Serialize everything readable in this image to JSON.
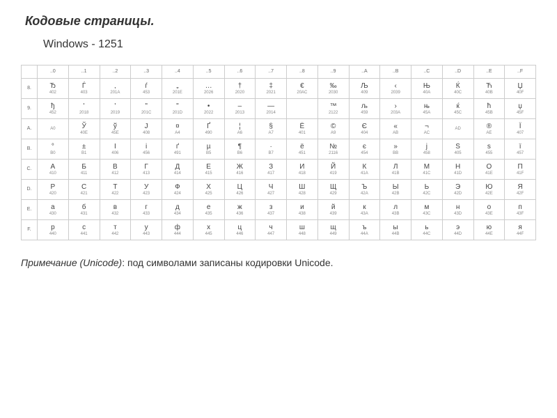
{
  "title": "Кодовые страницы.",
  "subtitle": "Windows - 1251",
  "note": {
    "label": "Примечание (Unicode)",
    "text": ": под символами записаны кодировки Unicode."
  },
  "chart_data": {
    "type": "table",
    "columns": [
      "..0",
      "..1",
      "..2",
      "..3",
      "..4",
      "..5",
      "..6",
      "..7",
      "..8",
      "..9",
      "..A",
      "..B",
      "..C",
      "..D",
      "..E",
      "..F"
    ],
    "row_labels": [
      "8.",
      "9.",
      "A.",
      "B.",
      "C.",
      "D.",
      "E.",
      "F."
    ],
    "cells": [
      [
        {
          "ch": "Ђ",
          "cd": "402"
        },
        {
          "ch": "Ѓ",
          "cd": "403"
        },
        {
          "ch": "‚",
          "cd": "201A"
        },
        {
          "ch": "ѓ",
          "cd": "453"
        },
        {
          "ch": "„",
          "cd": "201E"
        },
        {
          "ch": "…",
          "cd": "2026"
        },
        {
          "ch": "†",
          "cd": "2020"
        },
        {
          "ch": "‡",
          "cd": "2021"
        },
        {
          "ch": "€",
          "cd": "20AC"
        },
        {
          "ch": "‰",
          "cd": "2030"
        },
        {
          "ch": "Љ",
          "cd": "409"
        },
        {
          "ch": "‹",
          "cd": "2039"
        },
        {
          "ch": "Њ",
          "cd": "40A"
        },
        {
          "ch": "Ќ",
          "cd": "40C"
        },
        {
          "ch": "Ћ",
          "cd": "40B"
        },
        {
          "ch": "Џ",
          "cd": "40F"
        }
      ],
      [
        {
          "ch": "ђ",
          "cd": "452"
        },
        {
          "ch": "'",
          "cd": "2018"
        },
        {
          "ch": "'",
          "cd": "2019"
        },
        {
          "ch": "\"",
          "cd": "201C"
        },
        {
          "ch": "\"",
          "cd": "201D"
        },
        {
          "ch": "•",
          "cd": "2022"
        },
        {
          "ch": "–",
          "cd": "2013"
        },
        {
          "ch": "—",
          "cd": "2014"
        },
        {
          "ch": "",
          "cd": ""
        },
        {
          "ch": "™",
          "cd": "2122"
        },
        {
          "ch": "љ",
          "cd": "459"
        },
        {
          "ch": "›",
          "cd": "203A"
        },
        {
          "ch": "њ",
          "cd": "45A"
        },
        {
          "ch": "ќ",
          "cd": "45C"
        },
        {
          "ch": "ћ",
          "cd": "45B"
        },
        {
          "ch": "џ",
          "cd": "45F"
        }
      ],
      [
        {
          "ch": "",
          "cd": "A0"
        },
        {
          "ch": "Ў",
          "cd": "40E"
        },
        {
          "ch": "ў",
          "cd": "45E"
        },
        {
          "ch": "Ј",
          "cd": "408"
        },
        {
          "ch": "¤",
          "cd": "A4"
        },
        {
          "ch": "Ґ",
          "cd": "490"
        },
        {
          "ch": "¦",
          "cd": "A6"
        },
        {
          "ch": "§",
          "cd": "A7"
        },
        {
          "ch": "Ё",
          "cd": "401"
        },
        {
          "ch": "©",
          "cd": "A9"
        },
        {
          "ch": "Є",
          "cd": "404"
        },
        {
          "ch": "«",
          "cd": "AB"
        },
        {
          "ch": "¬",
          "cd": "AC"
        },
        {
          "ch": "",
          "cd": "AD"
        },
        {
          "ch": "®",
          "cd": "AE"
        },
        {
          "ch": "Ї",
          "cd": "407"
        }
      ],
      [
        {
          "ch": "°",
          "cd": "B0"
        },
        {
          "ch": "±",
          "cd": "B1"
        },
        {
          "ch": "І",
          "cd": "406"
        },
        {
          "ch": "і",
          "cd": "456"
        },
        {
          "ch": "ґ",
          "cd": "491"
        },
        {
          "ch": "µ",
          "cd": "B5"
        },
        {
          "ch": "¶",
          "cd": "B6"
        },
        {
          "ch": "·",
          "cd": "B7"
        },
        {
          "ch": "ё",
          "cd": "451"
        },
        {
          "ch": "№",
          "cd": "2116"
        },
        {
          "ch": "є",
          "cd": "454"
        },
        {
          "ch": "»",
          "cd": "BB"
        },
        {
          "ch": "ј",
          "cd": "458"
        },
        {
          "ch": "Ѕ",
          "cd": "405"
        },
        {
          "ch": "ѕ",
          "cd": "455"
        },
        {
          "ch": "ї",
          "cd": "457"
        }
      ],
      [
        {
          "ch": "А",
          "cd": "410"
        },
        {
          "ch": "Б",
          "cd": "411"
        },
        {
          "ch": "В",
          "cd": "412"
        },
        {
          "ch": "Г",
          "cd": "413"
        },
        {
          "ch": "Д",
          "cd": "414"
        },
        {
          "ch": "Е",
          "cd": "415"
        },
        {
          "ch": "Ж",
          "cd": "416"
        },
        {
          "ch": "З",
          "cd": "417"
        },
        {
          "ch": "И",
          "cd": "418"
        },
        {
          "ch": "Й",
          "cd": "419"
        },
        {
          "ch": "К",
          "cd": "41A"
        },
        {
          "ch": "Л",
          "cd": "41B"
        },
        {
          "ch": "М",
          "cd": "41C"
        },
        {
          "ch": "Н",
          "cd": "41D"
        },
        {
          "ch": "О",
          "cd": "41E"
        },
        {
          "ch": "П",
          "cd": "41F"
        }
      ],
      [
        {
          "ch": "Р",
          "cd": "420"
        },
        {
          "ch": "С",
          "cd": "421"
        },
        {
          "ch": "Т",
          "cd": "422"
        },
        {
          "ch": "У",
          "cd": "423"
        },
        {
          "ch": "Ф",
          "cd": "424"
        },
        {
          "ch": "Х",
          "cd": "425"
        },
        {
          "ch": "Ц",
          "cd": "426"
        },
        {
          "ch": "Ч",
          "cd": "427"
        },
        {
          "ch": "Ш",
          "cd": "428"
        },
        {
          "ch": "Щ",
          "cd": "429"
        },
        {
          "ch": "Ъ",
          "cd": "42A"
        },
        {
          "ch": "Ы",
          "cd": "42B"
        },
        {
          "ch": "Ь",
          "cd": "42C"
        },
        {
          "ch": "Э",
          "cd": "42D"
        },
        {
          "ch": "Ю",
          "cd": "42E"
        },
        {
          "ch": "Я",
          "cd": "42F"
        }
      ],
      [
        {
          "ch": "а",
          "cd": "430"
        },
        {
          "ch": "б",
          "cd": "431"
        },
        {
          "ch": "в",
          "cd": "432"
        },
        {
          "ch": "г",
          "cd": "433"
        },
        {
          "ch": "д",
          "cd": "434"
        },
        {
          "ch": "е",
          "cd": "435"
        },
        {
          "ch": "ж",
          "cd": "436"
        },
        {
          "ch": "з",
          "cd": "437"
        },
        {
          "ch": "и",
          "cd": "438"
        },
        {
          "ch": "й",
          "cd": "439"
        },
        {
          "ch": "к",
          "cd": "43A"
        },
        {
          "ch": "л",
          "cd": "43B"
        },
        {
          "ch": "м",
          "cd": "43C"
        },
        {
          "ch": "н",
          "cd": "43D"
        },
        {
          "ch": "о",
          "cd": "43E"
        },
        {
          "ch": "п",
          "cd": "43F"
        }
      ],
      [
        {
          "ch": "р",
          "cd": "440"
        },
        {
          "ch": "с",
          "cd": "441"
        },
        {
          "ch": "т",
          "cd": "442"
        },
        {
          "ch": "у",
          "cd": "443"
        },
        {
          "ch": "ф",
          "cd": "444"
        },
        {
          "ch": "х",
          "cd": "445"
        },
        {
          "ch": "ц",
          "cd": "446"
        },
        {
          "ch": "ч",
          "cd": "447"
        },
        {
          "ch": "ш",
          "cd": "448"
        },
        {
          "ch": "щ",
          "cd": "449"
        },
        {
          "ch": "ъ",
          "cd": "44A"
        },
        {
          "ch": "ы",
          "cd": "44B"
        },
        {
          "ch": "ь",
          "cd": "44C"
        },
        {
          "ch": "э",
          "cd": "44D"
        },
        {
          "ch": "ю",
          "cd": "44E"
        },
        {
          "ch": "я",
          "cd": "44F"
        }
      ]
    ]
  }
}
